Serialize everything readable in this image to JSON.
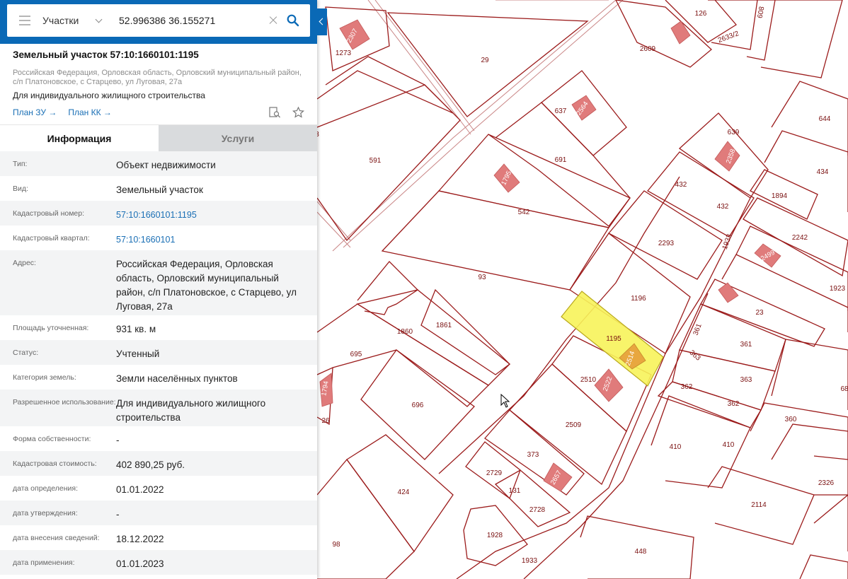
{
  "search": {
    "layer": "Участки",
    "query": "52.996386 36.155271"
  },
  "object": {
    "title": "Земельный участок 57:10:1660101:1195",
    "address_short": "Российская Федерация, Орловская область, Орловский муниципальный район, с/п Платоновское, с Старцево, ул Луговая, 27а",
    "purpose": "Для индивидуального жилищного строительства",
    "link_plan_zu": "План ЗУ →",
    "link_plan_kk": "План КК →"
  },
  "tabs": [
    {
      "label": "Информация",
      "active": true
    },
    {
      "label": "Услуги",
      "active": false
    }
  ],
  "info_rows": [
    {
      "key": "Тип:",
      "value": "Объект недвижимости"
    },
    {
      "key": "Вид:",
      "value": "Земельный участок"
    },
    {
      "key": "Кадастровый номер:",
      "value": "57:10:1660101:1195",
      "link": true
    },
    {
      "key": "Кадастровый квартал:",
      "value": "57:10:1660101",
      "link": true
    },
    {
      "key": "Адрес:",
      "value": "Российская Федерация, Орловская область, Орловский муниципальный район, с/п Платоновское, с Старцево, ул Луговая, 27а"
    },
    {
      "key": "Площадь уточненная:",
      "value": "931 кв. м"
    },
    {
      "key": "Статус:",
      "value": "Учтенный"
    },
    {
      "key": "Категория земель:",
      "value": "Земли населённых пунктов"
    },
    {
      "key": "Разрешенное использование:",
      "value": "Для индивидуального жилищного строительства"
    },
    {
      "key": "Форма собственности:",
      "value": "-"
    },
    {
      "key": "Кадастровая стоимость:",
      "value": "402 890,25 руб."
    },
    {
      "key": "дата определения:",
      "value": "01.01.2022"
    },
    {
      "key": "дата утверждения:",
      "value": "-"
    },
    {
      "key": "дата внесения сведений:",
      "value": "18.12.2022"
    },
    {
      "key": "дата применения:",
      "value": "01.01.2023"
    }
  ],
  "map_labels": {
    "parcels": [
      "29",
      "2609",
      "126",
      "2633/2",
      "608",
      "1273",
      "637",
      "591",
      "691",
      "639",
      "644",
      "434",
      "432",
      "432",
      "1894",
      "2242",
      "542",
      "2293",
      "1933",
      "93",
      "1196",
      "1923",
      "23",
      "1195",
      "361",
      "361",
      "1860",
      "1861",
      "695",
      "363",
      "363",
      "362",
      "362",
      "2510",
      "696",
      "2509",
      "360",
      "410",
      "410",
      "373",
      "2326",
      "2729",
      "131",
      "424",
      "2728",
      "2114",
      "1928",
      "98",
      "1933",
      "448",
      "26",
      "3",
      "68"
    ],
    "buildings": [
      "2307",
      "2564",
      "1795",
      "2358",
      "2499",
      "2514",
      "2522",
      "2657",
      "1794"
    ]
  },
  "colors": {
    "header": "#0a69b6",
    "parcel_border": "#9b1b1b",
    "building": "#e07b7b",
    "selected_parcel": "#f7f35a",
    "link": "#1a6fb5"
  },
  "icons": [
    "menu-icon",
    "chevron-down-icon",
    "close-icon",
    "search-icon",
    "document-search-icon",
    "star-icon",
    "collapse-arrow-icon",
    "mouse-cursor-icon"
  ]
}
